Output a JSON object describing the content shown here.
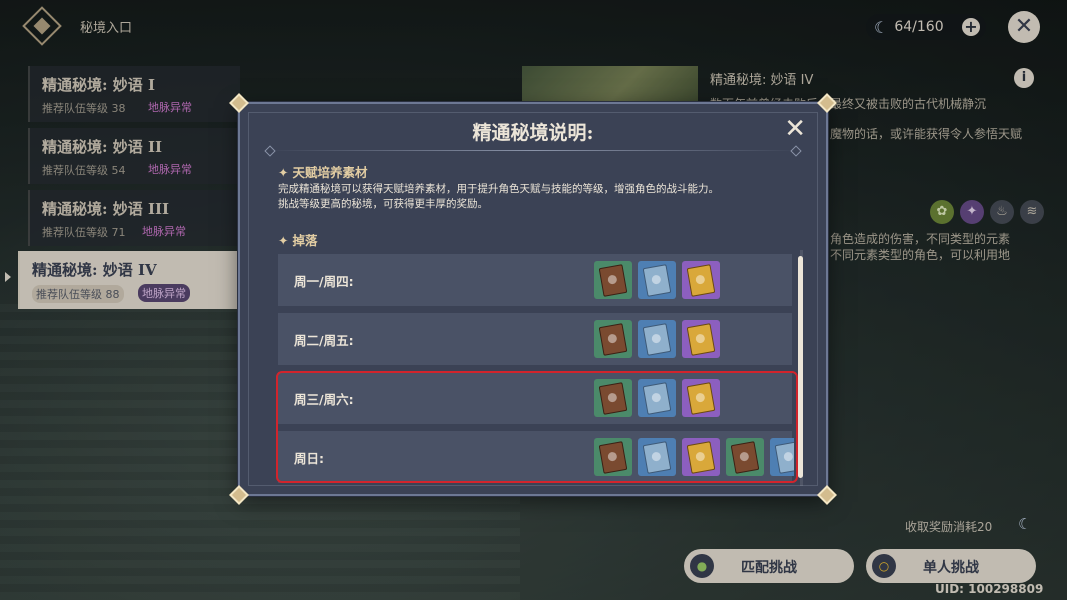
{
  "header": {
    "title": "秘境入口",
    "resin": "64/160"
  },
  "domains": [
    {
      "name": "精通秘境: 妙语 I",
      "level": "推荐队伍等级 38",
      "tag": "地脉异常"
    },
    {
      "name": "精通秘境: 妙语 II",
      "level": "推荐队伍等级 54",
      "tag": "地脉异常"
    },
    {
      "name": "精通秘境: 妙语 III",
      "level": "推荐队伍等级 71",
      "tag": "地脉异常"
    },
    {
      "name": "精通秘境: 妙语 IV",
      "level": "推荐队伍等级 88",
      "tag": "地脉异常"
    }
  ],
  "right_panel": {
    "title": "精通秘境: 妙语 IV",
    "desc_line1": "数百年前曾经击败后，最终又被击败的古代机械静沉",
    "desc_line2": "魔物的话，或许能获得令人参悟天赋",
    "desc_line3": "角色造成的伤害，不同类型的元素",
    "desc_line4": "不同元素类型的角色，可以利用地",
    "reward_cost": "收取奖励消耗20",
    "match_button": "匹配挑战",
    "solo_button": "单人挑战",
    "uid": "UID: 100298809"
  },
  "modal": {
    "title": "精通秘境说明:",
    "section1_title": "天赋培养素材",
    "section1_desc1": "完成精通秘境可以获得天赋培养素材，用于提升角色天赋与技能的等级，增强角色的战斗能力。",
    "section1_desc2": "挑战等级更高的秘境，可获得更丰厚的奖励。",
    "section2_title": "掉落",
    "rows": [
      {
        "day": "周一/周四:"
      },
      {
        "day": "周二/周五:"
      },
      {
        "day": "周三/周六:"
      },
      {
        "day": "周日:"
      }
    ]
  },
  "colors": {
    "modal_bg": "#3b4255",
    "row_bg": "#4a5266",
    "highlight": "#d2242c",
    "accent_text": "#e2cda3"
  }
}
